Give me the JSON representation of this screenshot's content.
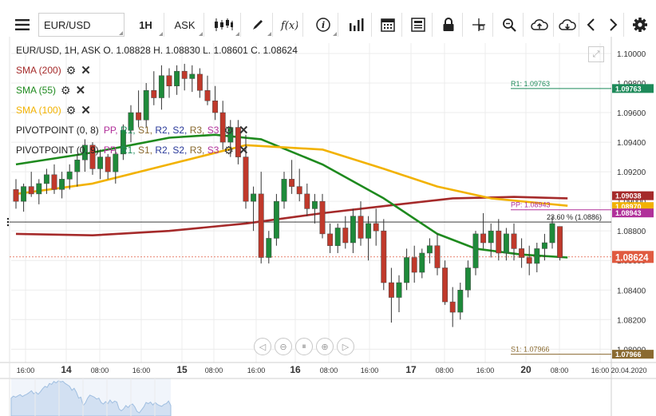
{
  "toolbar": {
    "symbol": "EUR/USD",
    "timeframe": "1H",
    "price_side": "ASK"
  },
  "legend": {
    "ohlc": "EUR/USD, 1H, ASK   O. 1.08828 H. 1.08830 L. 1.08601 C. 1.08624",
    "indicators": [
      {
        "label": "SMA (200)",
        "color": "#a52a2a"
      },
      {
        "label": "SMA (55)",
        "color": "#1e8a1e"
      },
      {
        "label": "SMA (100)",
        "color": "#f2b200"
      },
      {
        "label": "PIVOTPOINT (0, 8)"
      },
      {
        "label": "PIVOTPOINT (0, 9)"
      }
    ],
    "pivot_overlay": [
      "PP,",
      "R1,",
      "S1,",
      "R2,",
      "S2,",
      "R3,",
      "S3"
    ]
  },
  "chart_data": {
    "type": "candlestick",
    "symbol": "EUR/USD",
    "interval": "1H",
    "y_ticks": [
      "1.10000",
      "1.09800",
      "1.09600",
      "1.09400",
      "1.09200",
      "1.09000",
      "1.08800",
      "1.08600",
      "1.08400",
      "1.08200",
      "1.08000"
    ],
    "ylim": [
      1.0791,
      1.1007
    ],
    "x_ticks": [
      "16:00",
      "14",
      "08:00",
      "16:00",
      "15",
      "08:00",
      "16:00",
      "16",
      "08:00",
      "16:00",
      "17",
      "08:00",
      "16:00",
      "20",
      "08:00",
      "16:00"
    ],
    "x_end_label": "20.04.2020",
    "price_labels": [
      {
        "text": "1.09763",
        "value": 1.09763,
        "color": "#1e8a5a"
      },
      {
        "text": "1.09038",
        "value": 1.09038,
        "color": "#a52a2a"
      },
      {
        "text": "1.08970",
        "value": 1.0897,
        "color": "#f2b200"
      },
      {
        "text": "1.08943",
        "value": 1.08943,
        "color": "#b0309a"
      },
      {
        "text": "1.08624",
        "value": 1.08624,
        "color": "#e05a40"
      },
      {
        "text": "1.07966",
        "value": 1.07966,
        "color": "#8a6a30"
      }
    ],
    "annotations": [
      {
        "text": "R1: 1.09763",
        "value": 1.09763,
        "color": "#1e8a5a"
      },
      {
        "text": "PP: 1.08943",
        "value": 1.08943,
        "color": "#b0309a"
      },
      {
        "text": "S1: 1.07966",
        "value": 1.07966,
        "color": "#8a6a30"
      },
      {
        "text": "23.60 % (1.0886)",
        "value": 1.0886,
        "color": "#222222"
      }
    ],
    "last_price": 1.08624,
    "candles_ohlc": [
      [
        1.0908,
        1.0915,
        1.0895,
        1.09
      ],
      [
        1.09,
        1.0912,
        1.0893,
        1.091
      ],
      [
        1.091,
        1.092,
        1.0903,
        1.0905
      ],
      [
        1.0905,
        1.0915,
        1.0898,
        1.0912
      ],
      [
        1.0912,
        1.0922,
        1.0905,
        1.0918
      ],
      [
        1.0918,
        1.0925,
        1.0905,
        1.0908
      ],
      [
        1.0908,
        1.092,
        1.0902,
        1.0915
      ],
      [
        1.0915,
        1.0925,
        1.0908,
        1.092
      ],
      [
        1.092,
        1.0932,
        1.091,
        1.0928
      ],
      [
        1.0928,
        1.0942,
        1.092,
        1.0938
      ],
      [
        1.0938,
        1.094,
        1.0918,
        1.0922
      ],
      [
        1.0922,
        1.0935,
        1.0915,
        1.093
      ],
      [
        1.093,
        1.0932,
        1.0915,
        1.092
      ],
      [
        1.092,
        1.0935,
        1.0912,
        1.0932
      ],
      [
        1.0932,
        1.0952,
        1.0928,
        1.0948
      ],
      [
        1.0948,
        1.0965,
        1.094,
        1.096
      ],
      [
        1.096,
        1.0975,
        1.095,
        1.0955
      ],
      [
        1.0955,
        1.098,
        1.095,
        1.0975
      ],
      [
        1.0975,
        1.0988,
        1.0965,
        1.097
      ],
      [
        1.097,
        1.0992,
        1.0962,
        1.0985
      ],
      [
        1.0985,
        1.099,
        1.097,
        1.0978
      ],
      [
        1.0978,
        1.0992,
        1.0972,
        1.0988
      ],
      [
        1.0988,
        1.0993,
        1.0975,
        1.0983
      ],
      [
        1.0983,
        1.0992,
        1.0974,
        1.0986
      ],
      [
        1.0986,
        1.099,
        1.097,
        1.0975
      ],
      [
        1.0975,
        1.0985,
        1.0965,
        1.0968
      ],
      [
        1.0968,
        1.0978,
        1.0955,
        1.096
      ],
      [
        1.096,
        1.0968,
        1.0935,
        1.094
      ],
      [
        1.094,
        1.0955,
        1.093,
        1.095
      ],
      [
        1.095,
        1.0955,
        1.0925,
        1.093
      ],
      [
        1.093,
        1.0945,
        1.0895,
        1.09
      ],
      [
        1.09,
        1.091,
        1.088,
        1.0905
      ],
      [
        1.0905,
        1.092,
        1.0858,
        1.0862
      ],
      [
        1.0862,
        1.088,
        1.0858,
        1.0875
      ],
      [
        1.0875,
        1.0905,
        1.087,
        1.09
      ],
      [
        1.09,
        1.092,
        1.0895,
        1.0915
      ],
      [
        1.0915,
        1.0928,
        1.0905,
        1.091
      ],
      [
        1.091,
        1.0922,
        1.09,
        1.0905
      ],
      [
        1.0905,
        1.0912,
        1.089,
        1.0895
      ],
      [
        1.0895,
        1.0905,
        1.0885,
        1.09
      ],
      [
        1.09,
        1.0905,
        1.0875,
        1.0878
      ],
      [
        1.0878,
        1.0885,
        1.0865,
        1.087
      ],
      [
        1.087,
        1.0885,
        1.0865,
        1.0882
      ],
      [
        1.0882,
        1.089,
        1.0868,
        1.0872
      ],
      [
        1.0872,
        1.0895,
        1.0865,
        1.089
      ],
      [
        1.089,
        1.09,
        1.087,
        1.0875
      ],
      [
        1.0875,
        1.089,
        1.086,
        1.0885
      ],
      [
        1.0885,
        1.0895,
        1.087,
        1.088
      ],
      [
        1.088,
        1.0888,
        1.084,
        1.0845
      ],
      [
        1.0845,
        1.0855,
        1.0818,
        1.0835
      ],
      [
        1.0835,
        1.085,
        1.0825,
        1.0845
      ],
      [
        1.0845,
        1.0868,
        1.084,
        1.0862
      ],
      [
        1.0862,
        1.087,
        1.0845,
        1.0852
      ],
      [
        1.0852,
        1.0868,
        1.0848,
        1.0865
      ],
      [
        1.0865,
        1.0875,
        1.0858,
        1.087
      ],
      [
        1.087,
        1.0878,
        1.085,
        1.0855
      ],
      [
        1.0855,
        1.086,
        1.083,
        1.0832
      ],
      [
        1.0832,
        1.0842,
        1.0815,
        1.0825
      ],
      [
        1.0825,
        1.0845,
        1.082,
        1.084
      ],
      [
        1.084,
        1.086,
        1.0835,
        1.0855
      ],
      [
        1.0855,
        1.088,
        1.085,
        1.0878
      ],
      [
        1.0878,
        1.0892,
        1.0868,
        1.0872
      ],
      [
        1.0872,
        1.0885,
        1.0862,
        1.088
      ],
      [
        1.088,
        1.0888,
        1.086,
        1.0865
      ],
      [
        1.0865,
        1.0882,
        1.086,
        1.0878
      ],
      [
        1.0878,
        1.0885,
        1.086,
        1.0868
      ],
      [
        1.0868,
        1.0875,
        1.0855,
        1.0862
      ],
      [
        1.0862,
        1.087,
        1.085,
        1.0858
      ],
      [
        1.0858,
        1.0872,
        1.0852,
        1.0868
      ],
      [
        1.0868,
        1.0878,
        1.086,
        1.0872
      ],
      [
        1.0872,
        1.089,
        1.0868,
        1.0885
      ],
      [
        1.0883,
        1.0883,
        1.086,
        1.0862
      ]
    ],
    "sma_lines": [
      {
        "name": "SMA (200)",
        "color": "#a52a2a",
        "points": [
          [
            0,
            1.0878
          ],
          [
            10,
            1.0877
          ],
          [
            20,
            1.088
          ],
          [
            30,
            1.0885
          ],
          [
            40,
            1.0892
          ],
          [
            50,
            1.0898
          ],
          [
            57,
            1.0902
          ],
          [
            65,
            1.0903
          ],
          [
            72,
            1.0902
          ]
        ]
      },
      {
        "name": "SMA (55)",
        "color": "#1e8a1e",
        "points": [
          [
            0,
            1.0925
          ],
          [
            10,
            1.0933
          ],
          [
            20,
            1.0943
          ],
          [
            26,
            1.0945
          ],
          [
            32,
            1.0942
          ],
          [
            40,
            1.0925
          ],
          [
            48,
            1.0902
          ],
          [
            55,
            1.0878
          ],
          [
            60,
            1.0868
          ],
          [
            66,
            1.0864
          ],
          [
            72,
            1.0862
          ]
        ]
      },
      {
        "name": "SMA (100)",
        "color": "#f2b200",
        "points": [
          [
            0,
            1.0905
          ],
          [
            10,
            1.0912
          ],
          [
            20,
            1.0925
          ],
          [
            30,
            1.0938
          ],
          [
            40,
            1.0935
          ],
          [
            48,
            1.0922
          ],
          [
            55,
            1.091
          ],
          [
            62,
            1.0902
          ],
          [
            68,
            1.0899
          ],
          [
            72,
            1.0897
          ]
        ]
      }
    ]
  },
  "navigator": {
    "buttons": [
      "scroll-left",
      "zoom-out",
      "reset",
      "zoom-in",
      "scroll-right"
    ]
  }
}
